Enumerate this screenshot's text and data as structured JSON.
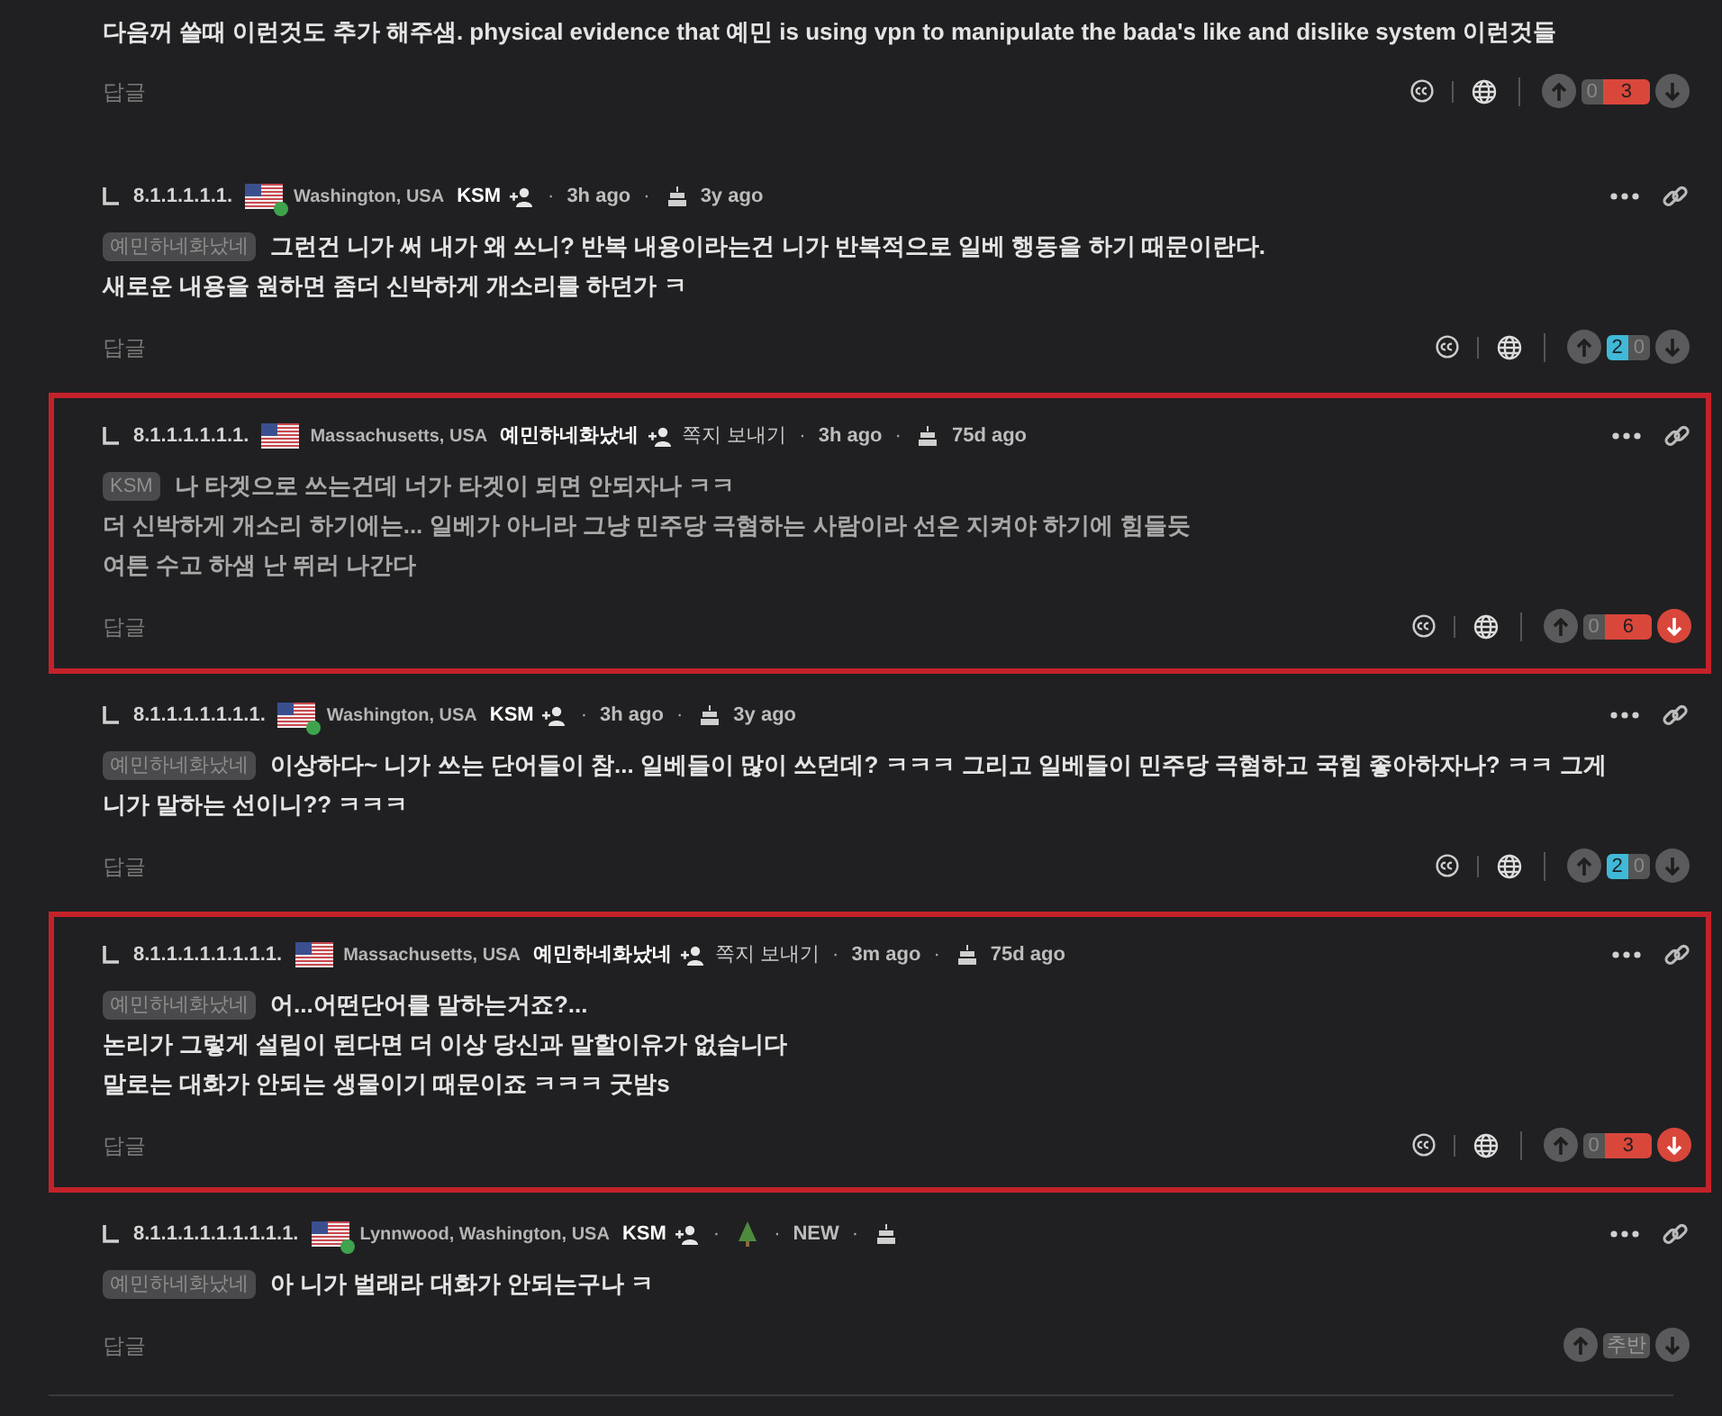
{
  "top_comment": {
    "body": [
      "다음꺼 쓸때 이런것도 추가 해주샘. physical evidence that 예민 is using vpn to manipulate the bada's like and dislike system 이런것들"
    ],
    "reply_label": "답글",
    "translate_icons": true,
    "votes": {
      "kind": "counts",
      "up": {
        "count": "0",
        "active": false
      },
      "down": {
        "count": "3",
        "active": true
      }
    },
    "downvoted": false
  },
  "replies": [
    {
      "highlighted": false,
      "number": "8.1.1.1.1.1.",
      "online": true,
      "location": "Washington, USA",
      "username": "KSM",
      "meta": [
        {
          "kind": "sep",
          "text": "·"
        },
        {
          "kind": "text",
          "text": "3h ago"
        },
        {
          "kind": "sep",
          "text": "·"
        },
        {
          "kind": "cake"
        },
        {
          "kind": "text",
          "text": "3y ago"
        }
      ],
      "mention": "예민하네화났네",
      "dim": false,
      "body": [
        "그런건 니가 써 내가 왜 쓰니? 반복 내용이라는건 니가 반복적으로 일베 행동을 하기 때문이란다.",
        "새로운 내용을 원하면 좀더 신박하게 개소리를 하던가 ㅋ"
      ],
      "reply_label": "답글",
      "translate_icons": true,
      "votes": {
        "kind": "counts",
        "up": {
          "count": "2",
          "active": true
        },
        "down": {
          "count": "0",
          "active": false
        }
      },
      "downvoted": false
    },
    {
      "highlighted": true,
      "number": "8.1.1.1.1.1.1.",
      "online": false,
      "location": "Massachusetts, USA",
      "username": "예민하네화났네",
      "meta": [
        {
          "kind": "link",
          "text": "쪽지 보내기"
        },
        {
          "kind": "sep",
          "text": "·"
        },
        {
          "kind": "text",
          "text": "3h ago"
        },
        {
          "kind": "sep",
          "text": "·"
        },
        {
          "kind": "cake"
        },
        {
          "kind": "text",
          "text": "75d ago"
        }
      ],
      "mention": "KSM",
      "dim": true,
      "body": [
        "나 타겟으로 쓰는건데 너가 타겟이 되면 안되자나 ㅋㅋ",
        "더 신박하게 개소리 하기에는... 일베가 아니라 그냥 민주당 극혐하는 사람이라 선은 지켜야 하기에 힘들듯",
        "여튼 수고 하샘 난 뛰러 나간다"
      ],
      "reply_label": "답글",
      "translate_icons": true,
      "votes": {
        "kind": "counts",
        "up": {
          "count": "0",
          "active": false
        },
        "down": {
          "count": "6",
          "active": true
        }
      },
      "downvoted": true
    },
    {
      "highlighted": false,
      "number": "8.1.1.1.1.1.1.1.",
      "online": true,
      "location": "Washington, USA",
      "username": "KSM",
      "meta": [
        {
          "kind": "sep",
          "text": "·"
        },
        {
          "kind": "text",
          "text": "3h ago"
        },
        {
          "kind": "sep",
          "text": "·"
        },
        {
          "kind": "cake"
        },
        {
          "kind": "text",
          "text": "3y ago"
        }
      ],
      "mention": "예민하네화났네",
      "dim": false,
      "body": [
        "이상하다~ 니가 쓰는 단어들이 참... 일베들이 많이 쓰던데? ㅋㅋㅋ 그리고 일베들이 민주당 극혐하고 국힘 좋아하자나? ㅋㅋ 그게",
        "니가 말하는 선이니?? ㅋㅋㅋ"
      ],
      "reply_label": "답글",
      "translate_icons": true,
      "votes": {
        "kind": "counts",
        "up": {
          "count": "2",
          "active": true
        },
        "down": {
          "count": "0",
          "active": false
        }
      },
      "downvoted": false
    },
    {
      "highlighted": true,
      "number": "8.1.1.1.1.1.1.1.1.",
      "online": false,
      "location": "Massachusetts, USA",
      "username": "예민하네화났네",
      "meta": [
        {
          "kind": "link",
          "text": "쪽지 보내기"
        },
        {
          "kind": "sep",
          "text": "·"
        },
        {
          "kind": "text",
          "text": "3m ago"
        },
        {
          "kind": "sep",
          "text": "·"
        },
        {
          "kind": "cake"
        },
        {
          "kind": "text",
          "text": "75d ago"
        }
      ],
      "mention": "예민하네화났네",
      "dim": false,
      "body": [
        "어...어떤단어를 말하는거죠?...",
        "논리가 그렇게 설립이 된다면 더 이상 당신과 말할이유가 없습니다",
        "말로는 대화가 안되는 생물이기 때문이죠 ㅋㅋㅋ 굿밤s"
      ],
      "reply_label": "답글",
      "translate_icons": true,
      "votes": {
        "kind": "counts",
        "up": {
          "count": "0",
          "active": false
        },
        "down": {
          "count": "3",
          "active": true
        }
      },
      "downvoted": true
    },
    {
      "highlighted": false,
      "number": "8.1.1.1.1.1.1.1.1.1.",
      "online": true,
      "location": "Lynnwood, Washington, USA",
      "username": "KSM",
      "meta": [
        {
          "kind": "sep",
          "text": "·"
        },
        {
          "kind": "tree"
        },
        {
          "kind": "sep",
          "text": "·"
        },
        {
          "kind": "text",
          "text": "NEW"
        },
        {
          "kind": "sep",
          "text": "·"
        },
        {
          "kind": "cake"
        }
      ],
      "mention": "예민하네화났네",
      "dim": false,
      "body": [
        "아 니가 벌래라 대화가 안되는구나 ㅋ"
      ],
      "reply_label": "답글",
      "translate_icons": false,
      "votes": {
        "kind": "label",
        "text": "추반"
      },
      "downvoted": false
    }
  ]
}
